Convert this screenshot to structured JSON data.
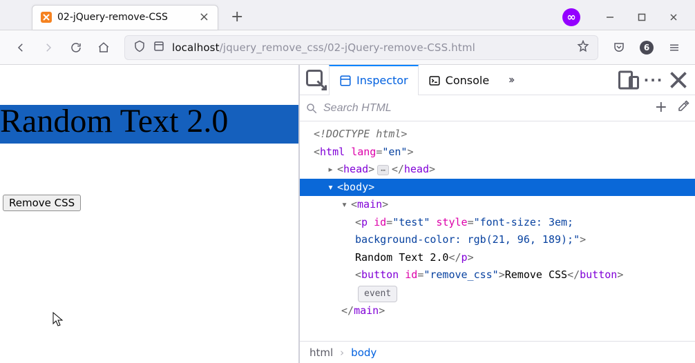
{
  "tab": {
    "title": "02-jQuery-remove-CSS"
  },
  "url": {
    "host": "localhost",
    "path": "/jquery_remove_css/02-jQuery-remove-CSS.html"
  },
  "toolbar": {
    "tracker_count": "6"
  },
  "page": {
    "random_text": "Random Text 2.0",
    "remove_btn_label": "Remove CSS"
  },
  "devtools": {
    "tabs": {
      "inspector": "Inspector",
      "console": "Console"
    },
    "search_placeholder": "Search HTML",
    "breadcrumbs": {
      "root": "html",
      "current": "body"
    },
    "dom": {
      "doctype": "<!DOCTYPE html>",
      "html_open": "html",
      "html_lang_attr": "lang",
      "html_lang_val": "\"en\"",
      "head": "head",
      "body": "body",
      "main": "main",
      "p_tag": "p",
      "p_id_attr": "id",
      "p_id_val": "\"test\"",
      "p_style_attr": "style",
      "p_style_val_1": "\"font-size: 3em;",
      "p_style_val_2": "background-color: rgb(21, 96, 189);\"",
      "p_text": "Random Text 2.0",
      "button_tag": "button",
      "button_id_attr": "id",
      "button_id_val": "\"remove_css\"",
      "button_text": "Remove CSS",
      "event_badge": "event",
      "main_close": "main"
    }
  }
}
